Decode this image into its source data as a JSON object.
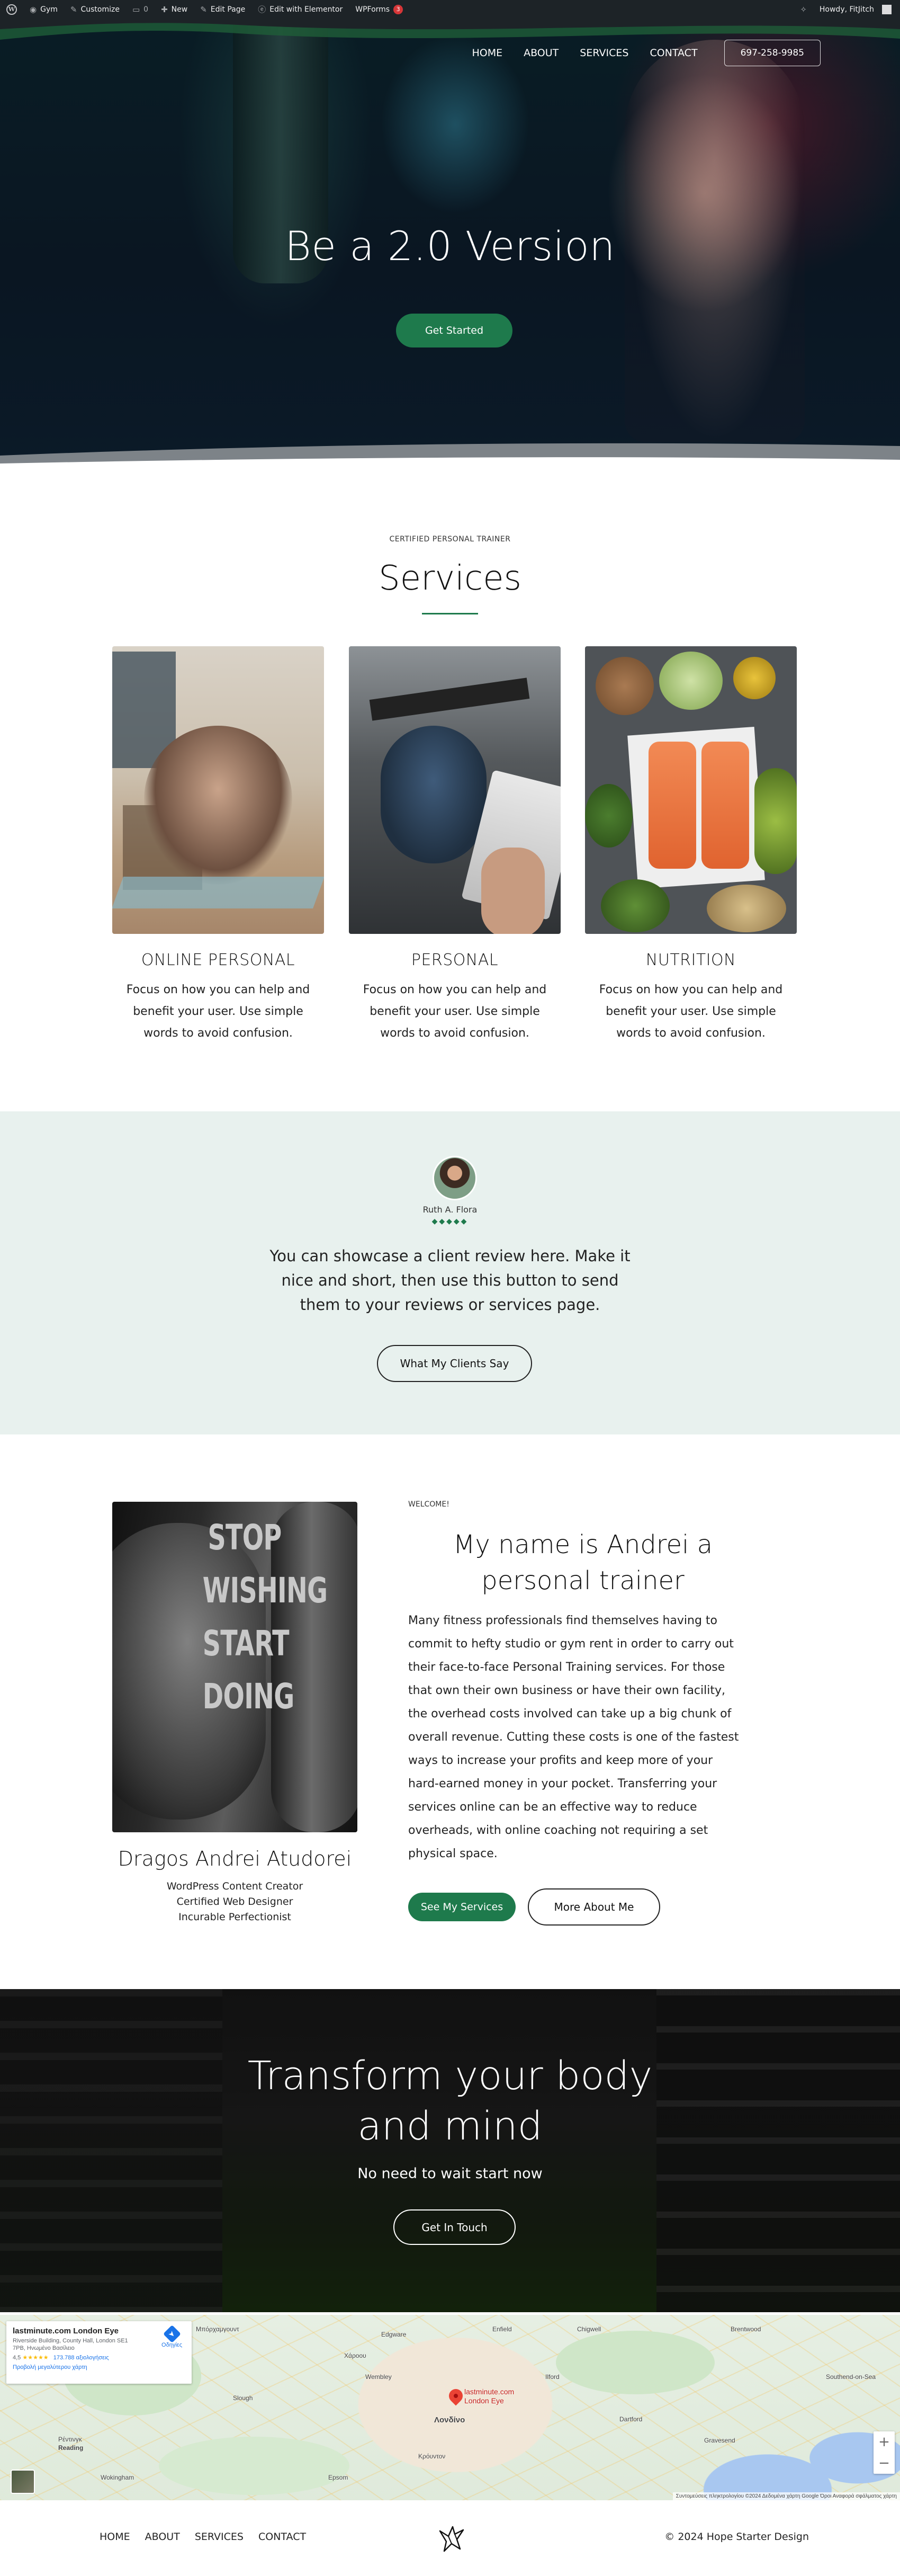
{
  "admin_bar": {
    "site_name": "Gym",
    "customize": "Customize",
    "comments_count": "0",
    "new": "New",
    "edit_page": "Edit Page",
    "edit_elementor": "Edit with Elementor",
    "wpforms": "WPForms",
    "wpforms_badge": "3",
    "howdy": "Howdy, FitJitch"
  },
  "nav": {
    "items": [
      "HOME",
      "ABOUT",
      "SERVICES",
      "CONTACT"
    ],
    "phone": "697-258-9985"
  },
  "hero": {
    "title": "Be a 2.0 Version",
    "button": "Get Started"
  },
  "services": {
    "eyebrow": "CERTIFIED PERSONAL TRAINER",
    "title": "Services",
    "cards": [
      {
        "name": "ONLINE PERSONAL",
        "desc": "Focus on how you can help and benefit your user. Use simple words to avoid confusion."
      },
      {
        "name": "PERSONAL",
        "desc": "Focus on how you can help and benefit your user. Use simple words to avoid confusion."
      },
      {
        "name": "NUTRITION",
        "desc": "Focus on how you can help and benefit your user. Use simple words to avoid confusion."
      }
    ]
  },
  "testimonial": {
    "name": "Ruth A. Flora",
    "stars": "◆◆◆◆◆",
    "quote": "You can showcase a client review here. Make it nice and short, then use this button to send them to your reviews or services page.",
    "button": "What My Clients Say"
  },
  "about": {
    "poster_text": [
      "STOP",
      "WISHING",
      "START",
      "DOING"
    ],
    "name": "Dragos Andrei Atudorei",
    "roles": [
      "WordPress Content Creator",
      "Certified Web Designer",
      "Incurable Perfectionist"
    ],
    "eyebrow": "WELCOME!",
    "title": "My name is Andrei a personal trainer",
    "body": "Many fitness professionals find themselves having to commit to hefty studio or gym rent in order to carry out their face-to-face Personal Training services. For those that own their own business or have their own facility, the overhead costs involved can take up a big chunk of overall revenue. Cutting these costs is one of the fastest ways to increase your profits and keep more of your hard-earned money in your pocket. Transferring your services online can be an effective way to reduce overheads, with online coaching not requiring a set physical space.",
    "button_primary": "See My Services",
    "button_secondary": "More About Me"
  },
  "cta": {
    "title_line1": "Transform your body",
    "title_line2": "and mind",
    "subtitle": "No need to wait start now",
    "button": "Get In Touch"
  },
  "map": {
    "place_name": "lastminute.com London Eye",
    "address": "Riverside Building, County Hall, London SE1 7PB, Ηνωμένο Βασίλειο",
    "rating": "4,5",
    "stars": "★★★★★",
    "reviews": "173.788 αξιολογήσεις",
    "larger_map": "Προβολή μεγαλύτερου χάρτη",
    "directions": "Οδηγίες",
    "pin_label_1": "lastminute.com",
    "pin_label_2": "London Eye",
    "towns": [
      "Μπόρχαμγουντ",
      "Edgware",
      "Enfield",
      "Chigwell",
      "Brentwood",
      "Χάροου",
      "Wembley",
      "Λονδίνο",
      "Ρέντινγκ",
      "Reading",
      "Wokingham",
      "Ilford",
      "Southend-on-Sea",
      "Dartford",
      "Gravesend",
      "Κρόυντον",
      "Slough",
      "Epsom"
    ],
    "zoom_in": "+",
    "zoom_out": "−",
    "attribution": "Συντομεύσεις πληκτρολογίου  ©2024 Δεδομένα χάρτη Google  Όροι  Αναφορά σφάλματος χάρτη"
  },
  "footer": {
    "nav": [
      "HOME",
      "ABOUT",
      "SERVICES",
      "CONTACT"
    ],
    "copyright": "© 2024 Hope Starter Design"
  },
  "colors": {
    "accent": "#1e7a4c",
    "testimonial_bg": "#e8f1ee",
    "admin_bar": "#1d2327"
  }
}
